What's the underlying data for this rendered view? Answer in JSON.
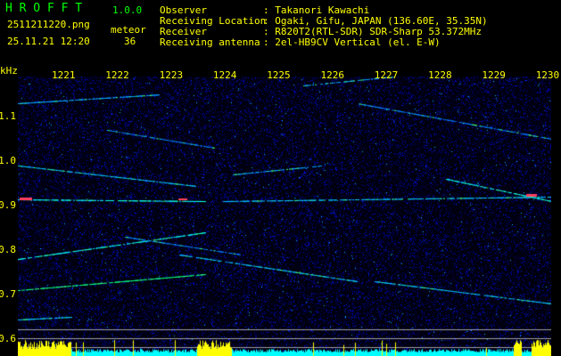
{
  "app": {
    "name": "H R O F F T",
    "version": "1.0.0"
  },
  "file": {
    "name": "2511211220.png",
    "datetime": "25.11.21 12:20"
  },
  "meteor": {
    "label": "meteor",
    "count": "36"
  },
  "info": [
    {
      "label": "Observer",
      "value": ": Takanori Kawachi"
    },
    {
      "label": "Receiving Location",
      "value": ": Ogaki, Gifu, JAPAN (136.60E, 35.35N)"
    },
    {
      "label": "Receiver",
      "value": ": R820T2(RTL-SDR) SDR-Sharp 53.372MHz"
    },
    {
      "label": "Receiving antenna",
      "value": ": 2el-HB9CV Vertical (el. E-W)"
    }
  ],
  "axes": {
    "y_unit": "kHz",
    "y_ticks": [
      "1.1",
      "1.0",
      "0.9",
      "0.8",
      "0.7",
      "0.6"
    ],
    "x_ticks": [
      "1221",
      "1222",
      "1223",
      "1224",
      "1225",
      "1226",
      "1227",
      "1228",
      "1229",
      "1230"
    ]
  },
  "colors": {
    "text": "#ffff00",
    "title": "#00ff00",
    "bg": "#000000",
    "noise": "#0000c0",
    "histogram": "#ffff00",
    "baseline": "#00ffff"
  }
}
